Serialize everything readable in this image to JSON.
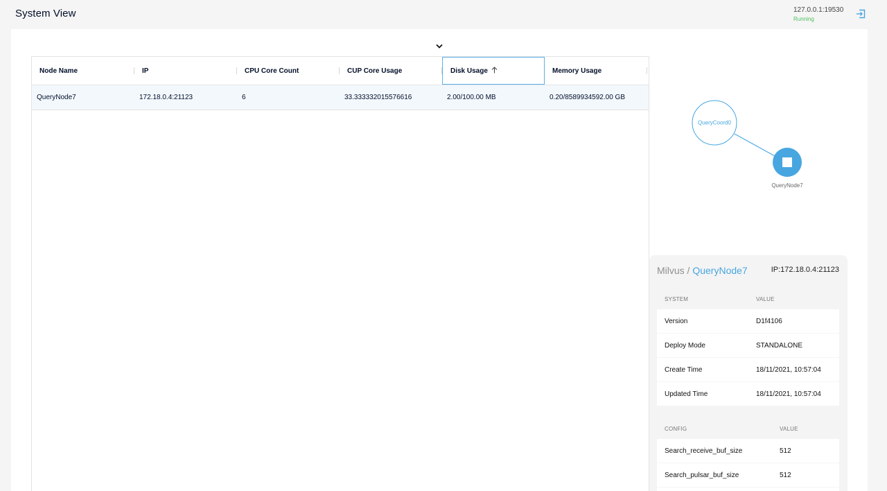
{
  "header": {
    "title": "System View",
    "server_address": "127.0.0.1:19530",
    "server_status": "Running"
  },
  "table": {
    "columns": [
      "Node Name",
      "IP",
      "CPU Core Count",
      "CUP Core Usage",
      "Disk Usage",
      "Memory Usage"
    ],
    "sorted_column": "Disk Usage",
    "sort_direction": "ascending",
    "rows": [
      [
        "QueryNode7",
        "172.18.0.4:21123",
        "6",
        "33.333332015576616",
        "2.00/100.00 MB",
        "0.20/8589934592.00 GB"
      ]
    ]
  },
  "topology": {
    "coord_label": "QueryCoord0",
    "node_label": "QueryNode7"
  },
  "detail": {
    "root": "Milvus",
    "separator": " / ",
    "current": "QueryNode7",
    "ip": "IP:172.18.0.4:21123",
    "system_header": [
      "SYSTEM",
      "VALUE"
    ],
    "system": [
      {
        "key": "Version",
        "value": "D1f4106"
      },
      {
        "key": "Deploy Mode",
        "value": "STANDALONE"
      },
      {
        "key": "Create Time",
        "value": "18/11/2021, 10:57:04"
      },
      {
        "key": "Updated Time",
        "value": "18/11/2021, 10:57:04"
      }
    ],
    "config_header": [
      "CONFIG",
      "VALUE"
    ],
    "config": [
      {
        "key": "Search_receive_buf_size",
        "value": "512"
      },
      {
        "key": "Search_pulsar_buf_size",
        "value": "512"
      }
    ]
  },
  "colors": {
    "accent": "#47a6e0",
    "status_running": "#4fc160",
    "selected_row": "#f3f8fd"
  },
  "icons": {
    "logout": "logout-icon",
    "collapse": "chevron-down-icon",
    "sort": "arrow-up-icon"
  }
}
